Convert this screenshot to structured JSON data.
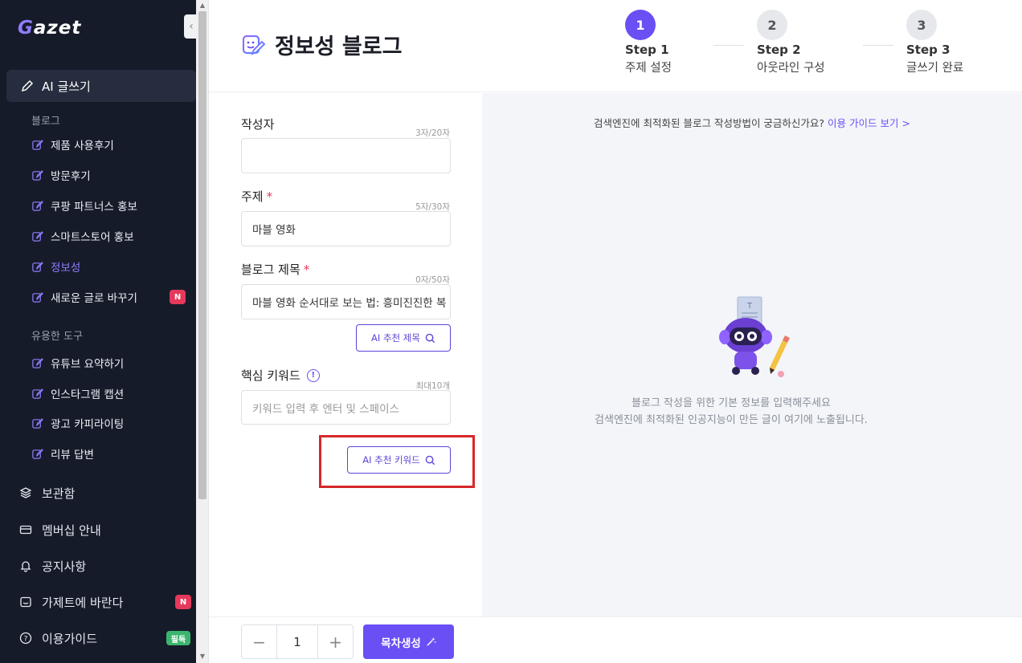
{
  "app": {
    "logo_first": "G",
    "logo_rest": "azet"
  },
  "sidebar": {
    "ai_write": "AI 글쓰기",
    "blog_section": "블로그",
    "blog_items": [
      {
        "label": "제품 사용후기"
      },
      {
        "label": "방문후기"
      },
      {
        "label": "쿠팡 파트너스 홍보"
      },
      {
        "label": "스마트스토어 홍보"
      },
      {
        "label": "정보성",
        "active": true
      },
      {
        "label": "새로운 글로 바꾸기",
        "badge": "N"
      }
    ],
    "tools_section": "유용한 도구",
    "tool_items": [
      {
        "label": "유튜브 요약하기"
      },
      {
        "label": "인스타그램 캡션"
      },
      {
        "label": "광고 카피라이팅"
      },
      {
        "label": "리뷰 답변"
      }
    ],
    "bottom_items": [
      {
        "label": "보관함"
      },
      {
        "label": "멤버십 안내"
      },
      {
        "label": "공지사항"
      },
      {
        "label": "가제트에 바란다",
        "badge": "N"
      },
      {
        "label": "이용가이드",
        "badge": "필독"
      }
    ]
  },
  "header": {
    "title": "정보성 블로그",
    "steps": [
      {
        "number": "1",
        "name": "Step 1",
        "desc": "주제 설정",
        "active": true
      },
      {
        "number": "2",
        "name": "Step 2",
        "desc": "아웃라인 구성"
      },
      {
        "number": "3",
        "name": "Step 3",
        "desc": "글쓰기 완료"
      }
    ]
  },
  "form": {
    "author": {
      "label": "작성자",
      "counter": "3자/20자",
      "value": ""
    },
    "topic": {
      "label": "주제",
      "required": "*",
      "counter": "5자/30자",
      "value": "마블 영화"
    },
    "blog_title": {
      "label": "블로그 제목",
      "required": "*",
      "counter": "0자/50자",
      "value": "마블 영화 순서대로 보는 법: 흥미진진한 복"
    },
    "ai_title_button": "AI 추천 제목",
    "keywords": {
      "label": "핵심 키워드",
      "info": "!",
      "counter": "최대10개",
      "placeholder": "키워드 입력 후 엔터 및 스페이스"
    },
    "ai_keyword_button": "AI 추천 키워드"
  },
  "preview": {
    "guide_text": "검색엔진에 최적화된 블로그 작성방법이 궁금하신가요?",
    "guide_link": "이용 가이드 보기 >",
    "empty_line1": "블로그 작성을 위한 기본 정보를 입력해주세요",
    "empty_line2": "검색엔진에 최적화된 인공지능이 만든 글이 여기에 노출됩니다."
  },
  "bottom_bar": {
    "quantity": "1",
    "minus": "−",
    "plus": "+",
    "generate_button": "목차생성"
  },
  "colors": {
    "accent": "#6a4ff5",
    "sidebar_bg": "#161b2a",
    "badge_new": "#e5395b",
    "badge_must": "#3bb56e",
    "highlight": "#d62828"
  }
}
